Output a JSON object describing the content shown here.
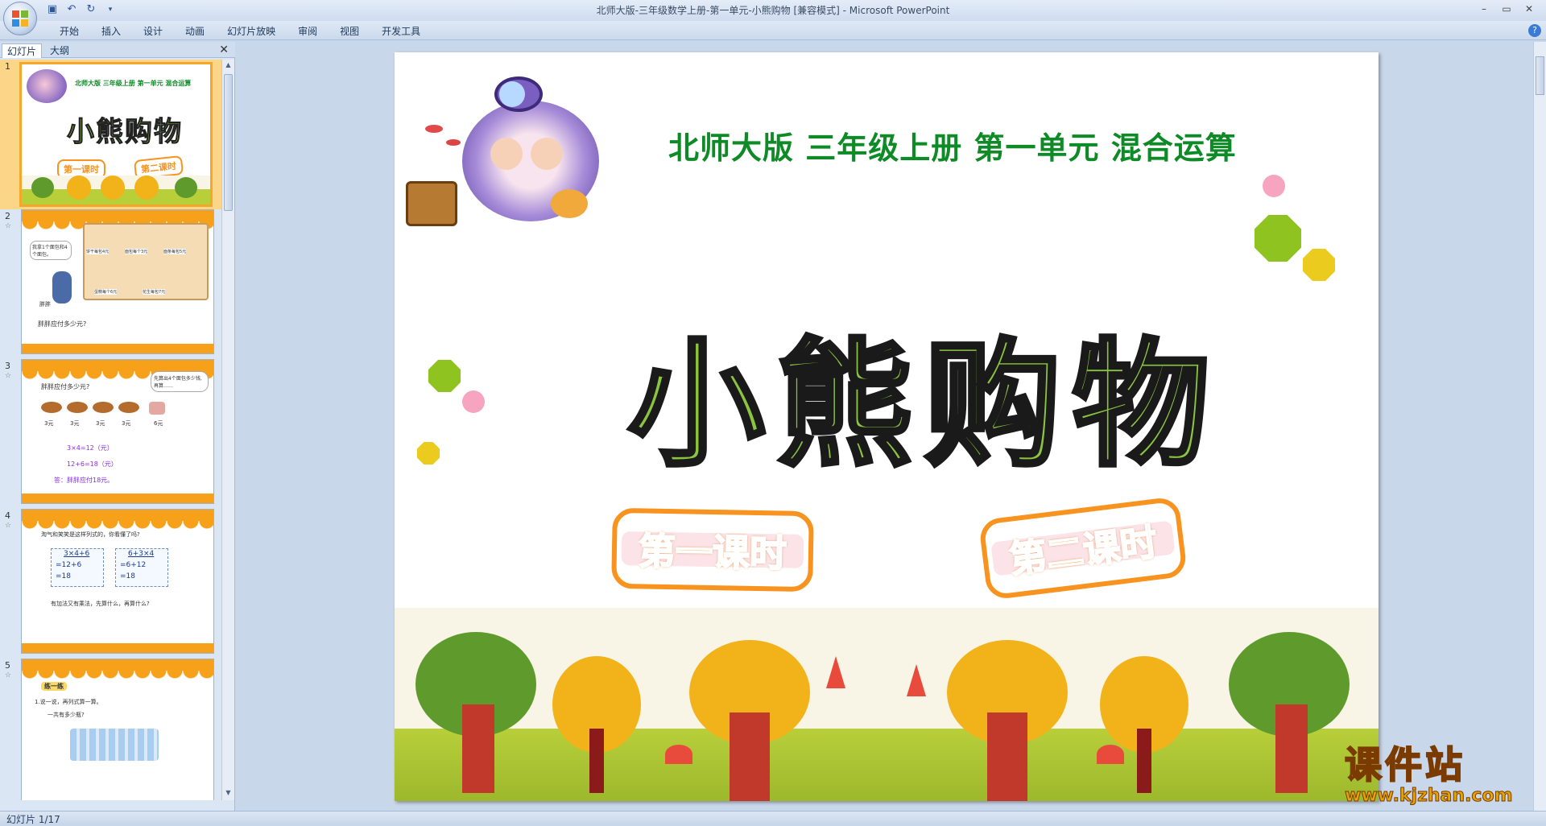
{
  "window": {
    "title": "北师大版-三年级数学上册-第一单元-小熊购物 [兼容模式] - Microsoft PowerPoint"
  },
  "ribbon": {
    "tabs": [
      "开始",
      "插入",
      "设计",
      "动画",
      "幻灯片放映",
      "审阅",
      "视图",
      "开发工具"
    ]
  },
  "panel": {
    "tab_slides": "幻灯片",
    "tab_outline": "大纲",
    "thumbnails": [
      {
        "num": "1",
        "title": "小熊购物",
        "header": "北师大版  三年级上册  第一单元  混合运算",
        "b1": "第一课时",
        "b2": "第二课时"
      },
      {
        "num": "2",
        "speech": "我拿1个面包和4个面包。",
        "labels": [
          "饼干每包4元",
          "面包每个3元",
          "面条每包5元",
          "蛋糕每个6元",
          "花生每包7元"
        ],
        "name": "胖胖",
        "question": "胖胖应付多少元?"
      },
      {
        "num": "3",
        "question": "胖胖应付多少元?",
        "speech": "先算出4个面包多少钱, 再算……",
        "prices": [
          "3元",
          "3元",
          "3元",
          "3元",
          "6元"
        ],
        "calc": [
          "3×4=12（元）",
          "12+6=18（元）",
          "答：胖胖应付18元。"
        ]
      },
      {
        "num": "4",
        "question": "淘气和笑笑是这样列式的，你看懂了吗?",
        "left": [
          "3×4+6",
          "=12+6",
          "=18"
        ],
        "right": [
          "6+3×4",
          "=6+12",
          "=18"
        ],
        "q2": "有加法又有乘法，先算什么，再算什么?"
      },
      {
        "num": "5",
        "header": "练一练",
        "line1": "1.说一说，再列式算一算。",
        "line2": "一共有多少瓶?"
      }
    ]
  },
  "slide": {
    "subtitle": "北师大版  三年级上册  第一单元  混合运算",
    "title": "小熊购物",
    "lesson1": "第一课时",
    "lesson2": "第二课时"
  },
  "status": {
    "slide_counter": "幻灯片 1/17"
  },
  "watermark": {
    "title": "课件站",
    "url": "www.kjzhan.com"
  },
  "colors": {
    "accent_orange": "#f7931e",
    "title_green": "#8bc53f",
    "subtitle_green": "#0e8a26"
  }
}
